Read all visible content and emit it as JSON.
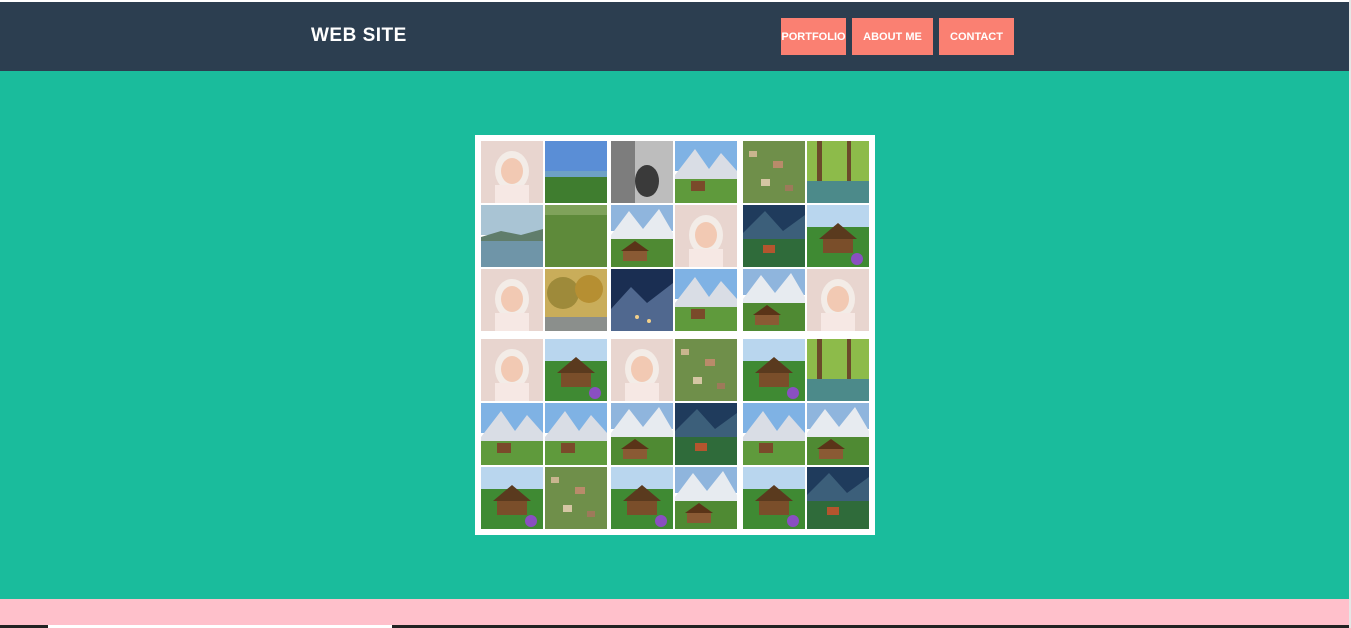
{
  "header": {
    "logo": "WEB SITE",
    "nav": [
      {
        "label": "PORTFOLIO"
      },
      {
        "label": "ABOUT ME"
      },
      {
        "label": "CONTACT"
      }
    ]
  },
  "colors": {
    "header_bg": "#2c3e50",
    "main_bg": "#1abc9c",
    "nav_button_bg": "#fa8072",
    "footer_bg": "#ffc0cb"
  },
  "collage": {
    "grid": "6x6",
    "tiles": [
      "portrait",
      "landscape",
      "bw-portrait",
      "mountain-village",
      "aerial-village",
      "canal",
      "lake",
      "field",
      "mountain-chalet",
      "portrait",
      "alpine-night-village",
      "garden-chalet",
      "portrait",
      "autumn-trees",
      "night-mountain",
      "mountain-village",
      "mountain-chalet",
      "portrait",
      "portrait",
      "garden-chalet",
      "portrait",
      "aerial-village",
      "garden-chalet",
      "canal",
      "mountain-village",
      "mountain-village",
      "mountain-chalet",
      "alpine-night-village",
      "mountain-village",
      "mountain-chalet",
      "garden-chalet",
      "aerial-village",
      "garden-chalet",
      "mountain-chalet",
      "garden-chalet",
      "alpine-night-village"
    ]
  }
}
